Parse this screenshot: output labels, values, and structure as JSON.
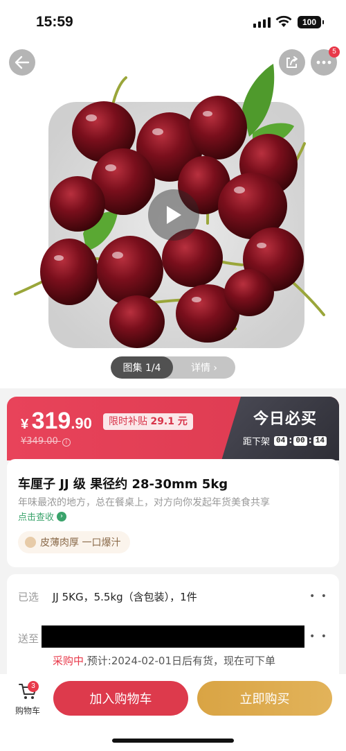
{
  "status_bar": {
    "time": "15:59",
    "battery": "100"
  },
  "hero": {
    "more_badge": "5",
    "gallery_label": "图集 1/4",
    "detail_label": "详情 ›"
  },
  "price": {
    "currency": "¥",
    "integer": "319",
    "decimal": ".90",
    "subsidy_label": "限时补贴",
    "subsidy_amount": "29.1 元",
    "original_price": "¥349.00",
    "info_glyph": "i",
    "today_title": "今日必买",
    "countdown_label": "距下架",
    "countdown": [
      "04",
      "00",
      "14"
    ],
    "accent_color": "#e8435a"
  },
  "product": {
    "title": "车厘子 JJ 级 果径约 28-30mm 5kg",
    "description": "年味最浓的地方，总在餐桌上，对方向你发起年货美食共享",
    "check_link": "点击查收",
    "check_arrow": "›",
    "feature_tag": "皮薄肉厚 一口爆汁"
  },
  "selection": {
    "selected_label": "已选",
    "selected_value": "JJ 5KG，5.5kg（含包装），1件",
    "ship_label": "送至",
    "dots": "•  •",
    "purchase_status": "采购中",
    "purchase_note": ",预计:2024-02-01日后有货，现在可下单"
  },
  "bottom_bar": {
    "cart_badge": "3",
    "cart_label": "购物车",
    "add_cart": "加入购物车",
    "buy_now": "立即购买"
  }
}
